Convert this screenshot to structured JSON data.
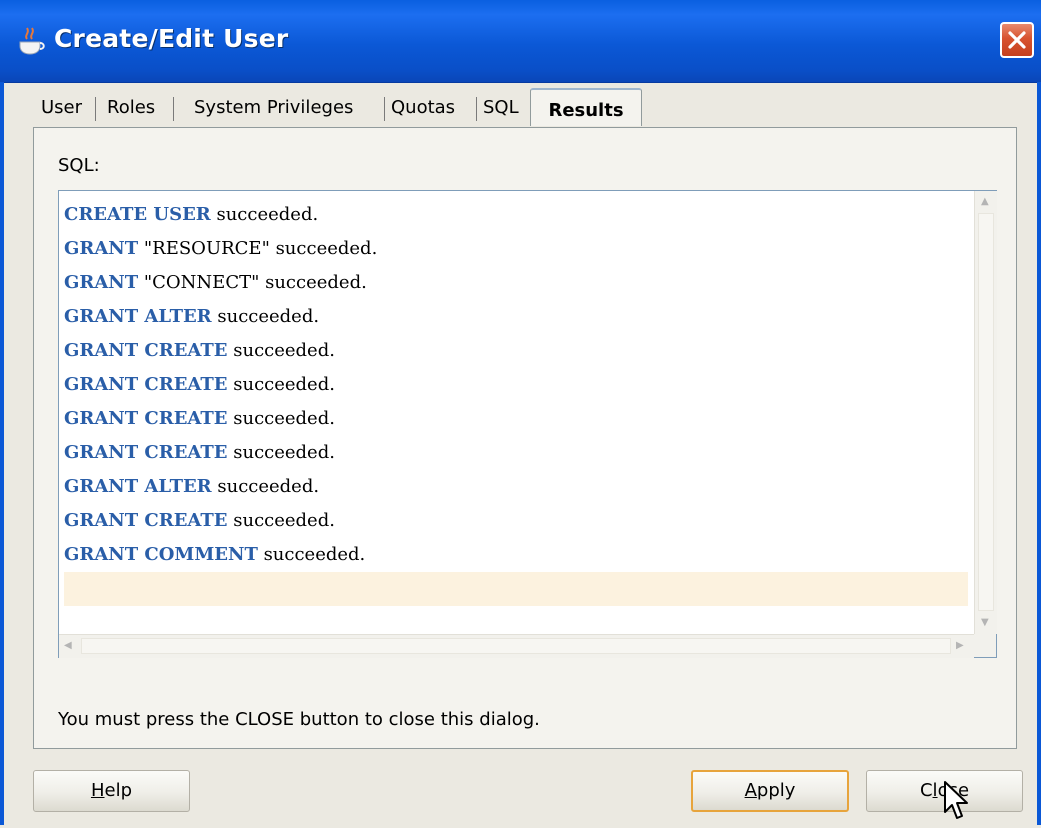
{
  "window": {
    "title": "Create/Edit User",
    "icon": "java-cup-icon",
    "close_icon": "close-x-icon"
  },
  "tabs": [
    {
      "label": "User",
      "active": false
    },
    {
      "label": "Roles",
      "active": false
    },
    {
      "label": "System Privileges",
      "active": false
    },
    {
      "label": "Quotas",
      "active": false
    },
    {
      "label": "SQL",
      "active": false
    },
    {
      "label": "Results",
      "active": true
    }
  ],
  "results": {
    "label": "SQL:",
    "lines": [
      {
        "kw": "CREATE USER",
        "rest": " succeeded."
      },
      {
        "kw": "GRANT",
        "rest": " \"RESOURCE\" succeeded."
      },
      {
        "kw": "GRANT",
        "rest": " \"CONNECT\" succeeded."
      },
      {
        "kw": "GRANT ALTER",
        "rest": " succeeded."
      },
      {
        "kw": "GRANT CREATE",
        "rest": " succeeded."
      },
      {
        "kw": "GRANT CREATE",
        "rest": " succeeded."
      },
      {
        "kw": "GRANT CREATE",
        "rest": " succeeded."
      },
      {
        "kw": "GRANT CREATE",
        "rest": " succeeded."
      },
      {
        "kw": "GRANT ALTER",
        "rest": " succeeded."
      },
      {
        "kw": "GRANT CREATE",
        "rest": " succeeded."
      },
      {
        "kw": "GRANT COMMENT",
        "rest": " succeeded."
      }
    ],
    "notice": "You must press the CLOSE button to close this dialog."
  },
  "buttons": {
    "help": {
      "mnemonic": "H",
      "rest": "elp"
    },
    "apply": {
      "mnemonic": "A",
      "rest": "pply"
    },
    "close": {
      "pre": "C",
      "mnemonic": "l",
      "rest": "ose"
    }
  },
  "colors": {
    "titlebar": "#0b58d6",
    "keyword": "#2a5ea8",
    "current_line": "#fcf2df",
    "focus_border": "#e7a43c"
  }
}
